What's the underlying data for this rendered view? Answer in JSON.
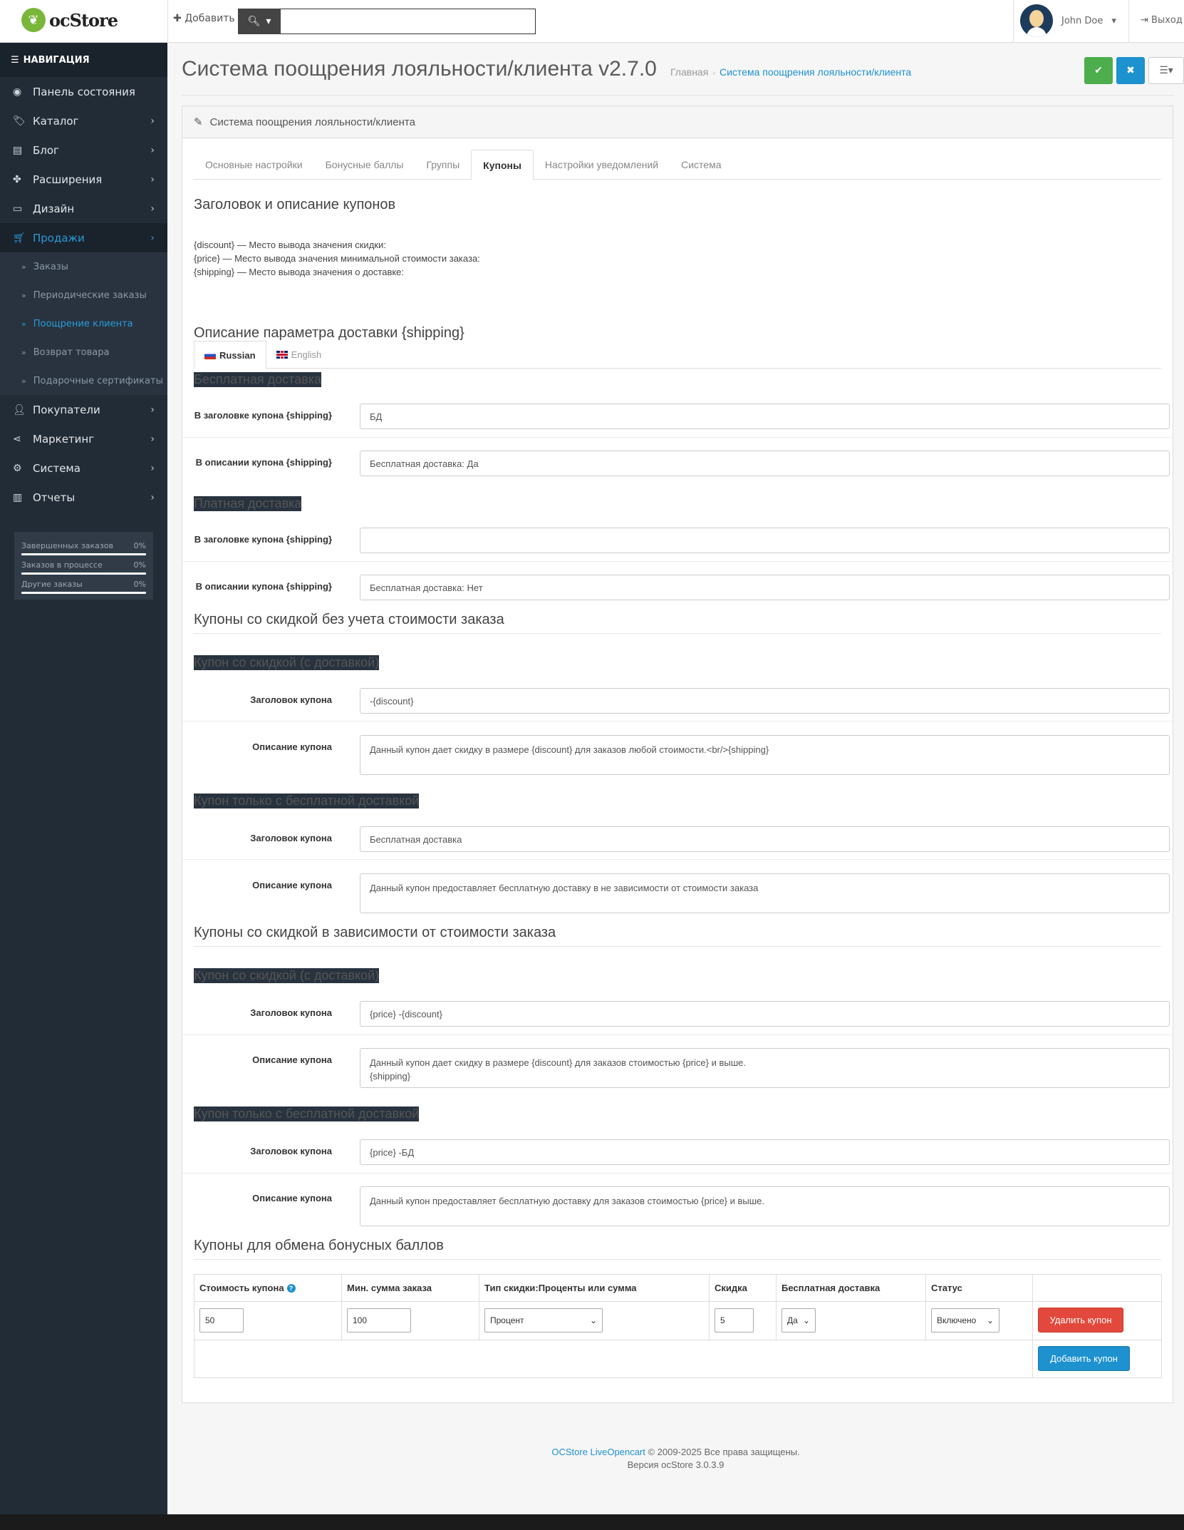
{
  "header": {
    "logo_text": "ocStore",
    "add_label": "Добавить",
    "search_placeholder": "",
    "user_name": "John Doe",
    "logout_label": "Выход"
  },
  "sidebar": {
    "title": "НАВИГАЦИЯ",
    "items": [
      {
        "label": "Панель состояния",
        "icon": "dashboard-icon"
      },
      {
        "label": "Каталог",
        "icon": "tags-icon"
      },
      {
        "label": "Блог",
        "icon": "book-icon"
      },
      {
        "label": "Расширения",
        "icon": "puzzle-icon"
      },
      {
        "label": "Дизайн",
        "icon": "monitor-icon"
      },
      {
        "label": "Продажи",
        "icon": "cart-icon"
      },
      {
        "label": "Покупатели",
        "icon": "user-icon"
      },
      {
        "label": "Маркетинг",
        "icon": "share-icon"
      },
      {
        "label": "Система",
        "icon": "cog-icon"
      },
      {
        "label": "Отчеты",
        "icon": "bar-chart-icon"
      }
    ],
    "sales_sub": [
      "Заказы",
      "Периодические заказы",
      "Поощрение клиента",
      "Возврат товара",
      "Подарочные сертификаты"
    ],
    "stats": [
      {
        "label": "Завершенных заказов",
        "value": "0%"
      },
      {
        "label": "Заказов в процессе",
        "value": "0%"
      },
      {
        "label": "Другие заказы",
        "value": "0%"
      }
    ]
  },
  "page": {
    "title": "Система поощрения лояльности/клиента v2.7.0",
    "breadcrumb_home": "Главная",
    "breadcrumb_current": "Система поощрения лояльности/клиента",
    "panel_title": "Система поощрения лояльности/клиента",
    "tabs": [
      "Основные настройки",
      "Бонусные баллы",
      "Группы",
      "Купоны",
      "Настройки уведомлений",
      "Система"
    ],
    "active_tab": "Купоны"
  },
  "coupons": {
    "heading": "Заголовок и описание купонов",
    "help": [
      "{discount} — Место вывода значения скидки:",
      "{price} — Место вывода значения минимальной стоимости заказа:",
      "{shipping} — Место вывода значения о доставке:"
    ],
    "lang_tabs": [
      "Russian",
      "English"
    ],
    "shipping_heading": "Описание параметра доставки {shipping}",
    "free_shipping": "Бесплатная доставка",
    "paid_shipping": "Платная доставка",
    "label_title_shipping": "В заголовке купона {shipping}",
    "label_desc_shipping": "В описании купона {shipping}",
    "free_title_value": "БД",
    "free_desc_value": "Бесплатная доставка: Да",
    "paid_title_value": "",
    "paid_desc_value": "Бесплатная доставка: Нет",
    "no_cost_heading": "Купоны со скидкой без учета стоимости заказа",
    "with_cost_heading": "Купоны со скидкой в зависимости от стоимости заказа",
    "discount_with_shipping": "Купон со скидкой (с доставкой)",
    "free_shipping_only": "Купон только с бесплатной доставкой",
    "label_coupon_title": "Заголовок купона",
    "label_coupon_desc": "Описание купона",
    "nc_discount_title": "-{discount}",
    "nc_discount_desc": "Данный купон дает скидку в размере {discount} для заказов любой стоимости.<br/>{shipping}",
    "nc_free_title": "Бесплатная доставка",
    "nc_free_desc": "Данный купон предоставляет бесплатную доставку в не зависимости от стоимости заказа",
    "wc_discount_title": "{price} -{discount}",
    "wc_discount_desc": "Данный купон дает скидку в размере {discount} для заказов стоимостью {price} и выше.\n{shipping}",
    "wc_free_title": "{price} -БД",
    "wc_free_desc": "Данный купон предоставляет бесплатную доставку для заказов стоимостью {price} и выше.",
    "exchange_heading": "Купоны для обмена бонусных баллов",
    "table_headers": [
      "Стоимость купона",
      "Мин. сумма заказа",
      "Тип скидки:Проценты или сумма",
      "Скидка",
      "Бесплатная доставка",
      "Статус"
    ],
    "row": {
      "cost": "50",
      "min_sum": "100",
      "type": "Процент",
      "discount": "5",
      "free_shipping": "Да",
      "status": "Включено"
    },
    "delete_label": "Удалить купон",
    "add_label": "Добавить купон"
  },
  "footer": {
    "link": "OCStore LiveOpencart",
    "copyright": " © 2009-2025 Все права защищены.",
    "version": "Версия ocStore 3.0.3.9"
  }
}
